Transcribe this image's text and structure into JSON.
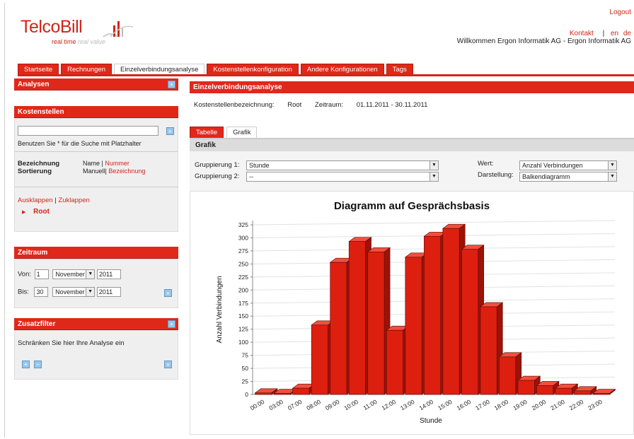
{
  "header": {
    "logo": "TelcoBill",
    "tagline_main": "real time",
    "tagline_accent": "real value",
    "logout": "Logout",
    "contact": "Kontakt",
    "separator": "|",
    "lang_en": "en",
    "lang_de": "de",
    "welcome": "Willkommen Ergon Informatik AG - Ergon Informatik AG"
  },
  "nav": {
    "tabs": [
      "Startseite",
      "Rechnungen",
      "Einzelverbindungsanalyse",
      "Kostenstellenkonfiguration",
      "Andere Konfigurationen",
      "Tags"
    ],
    "active_index": 2
  },
  "sidebar": {
    "analysen": {
      "title": "Analysen"
    },
    "kostenstellen": {
      "title": "Kostenstellen",
      "search_value": "",
      "search_hint": "Benutzen Sie * für die Suche mit Platzhalter",
      "bezeichnung_label": "Bezeichnung",
      "bezeichnung_opt1": "Name",
      "bezeichnung_sep": "|",
      "bezeichnung_opt2": "Nummer",
      "sortierung_label": "Sortierung",
      "sortierung_opt1": "Manuell",
      "sortierung_sep": "|",
      "sortierung_opt2": "Bezeichnung",
      "ausklappen": "Ausklappen",
      "link_sep": "|",
      "zuklappen": "Zuklappen",
      "tree_root": "Root"
    },
    "zeitraum": {
      "title": "Zeitraum",
      "von_label": "Von:",
      "von_day": "1",
      "von_month": "November",
      "von_year": "2011",
      "bis_label": "Bis:",
      "bis_day": "30",
      "bis_month": "November",
      "bis_year": "2011"
    },
    "zusatzfilter": {
      "title": "Zusatzfilter",
      "text": "Schränken Sie hier Ihre Analyse ein"
    }
  },
  "main": {
    "title": "Einzelverbindungsanalyse",
    "kst_label": "Kostenstellenbezeichnung:",
    "kst_value": "Root",
    "zeitraum_label": "Zeitraum:",
    "zeitraum_value": "01.11.2011 - 30.11.2011",
    "tabs": [
      "Tabelle",
      "Grafik"
    ],
    "active_tab": 1,
    "section_title": "Grafik",
    "gruppierung1_label": "Gruppierung 1:",
    "gruppierung1_value": "Stunde",
    "gruppierung2_label": "Gruppierung 2:",
    "gruppierung2_value": "--",
    "wert_label": "Wert:",
    "wert_value": "Anzahl Verbindungen",
    "darstellung_label": "Darstellung:",
    "darstellung_value": "Balkendiagramm"
  },
  "colors": {
    "accent": "#e0281a",
    "bar": "#dd1f10",
    "bar_top": "#f0503e",
    "bar_side": "#9c1208"
  },
  "chart_data": {
    "type": "bar",
    "title": "Diagramm auf Gesprächsbasis",
    "xlabel": "Stunde",
    "ylabel": "Anzahl Verbindungen",
    "ylim": [
      0,
      325
    ],
    "yticks": [
      0,
      25,
      50,
      75,
      100,
      125,
      150,
      175,
      200,
      225,
      250,
      275,
      300,
      325
    ],
    "categories": [
      "00:00",
      "03:00",
      "07:00",
      "08:00",
      "09:00",
      "10:00",
      "11:00",
      "12:00",
      "13:00",
      "14:00",
      "15:00",
      "16:00",
      "17:00",
      "18:00",
      "19:00",
      "20:00",
      "21:00",
      "22:00",
      "23:00"
    ],
    "values": [
      3,
      2,
      12,
      133,
      253,
      293,
      273,
      123,
      263,
      303,
      318,
      278,
      168,
      72,
      27,
      17,
      12,
      7,
      2
    ],
    "grid": true,
    "legend": "none"
  }
}
